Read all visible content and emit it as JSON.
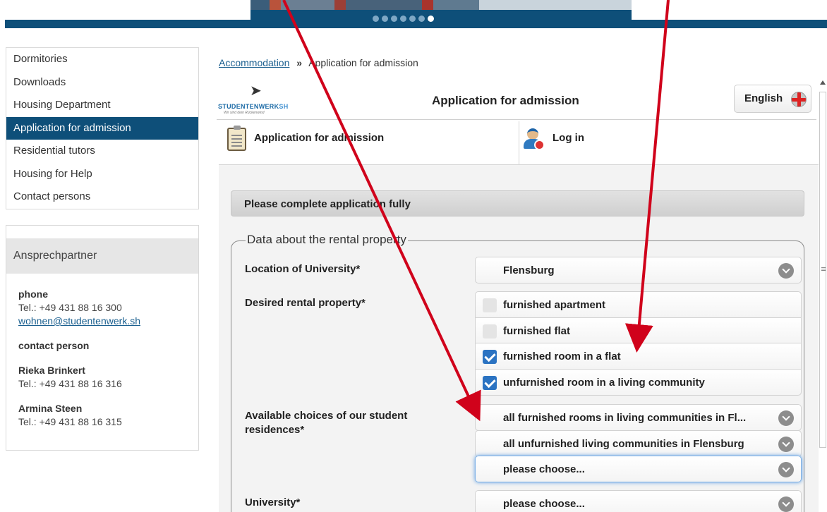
{
  "banner": {
    "dots": 7,
    "active_dot": 7
  },
  "nav": {
    "items": [
      {
        "label": "Dormitories",
        "active": false
      },
      {
        "label": "Downloads",
        "active": false
      },
      {
        "label": "Housing Department",
        "active": false
      },
      {
        "label": "Application for admission",
        "active": true
      },
      {
        "label": "Residential tutors",
        "active": false
      },
      {
        "label": "Housing for Help",
        "active": false
      },
      {
        "label": "Contact persons",
        "active": false
      }
    ]
  },
  "contact": {
    "title": "Ansprechpartner",
    "phone_label": "phone",
    "phone": "Tel.: +49 431 88 16 300",
    "email": "wohnen@studentenwerk.sh",
    "person_label": "contact person",
    "persons": [
      {
        "name": "Rieka Brinkert",
        "phone": "Tel.: +49 431 88 16 316"
      },
      {
        "name": "Armina Steen",
        "phone": "Tel.: +49 431 88 16 315"
      }
    ]
  },
  "breadcrumb": {
    "link": "Accommodation",
    "separator": "»",
    "current": "Application for admission"
  },
  "header": {
    "logo_brand": "STUDENTENWERK",
    "logo_brand_suffix": "SH",
    "logo_tagline": "Wir sind dein Rückenwind",
    "title": "Application for admission",
    "language": "English"
  },
  "subnav": {
    "apply": "Application for admission",
    "login": "Log in"
  },
  "form": {
    "notice": "Please complete application fully",
    "legend": "Data about the rental property",
    "location_label": "Location of University*",
    "location_value": "Flensburg",
    "property_label": "Desired rental property*",
    "property_options": [
      {
        "label": "furnished apartment",
        "checked": false
      },
      {
        "label": "furnished flat",
        "checked": false
      },
      {
        "label": "furnished room in a flat",
        "checked": true
      },
      {
        "label": "unfurnished room in a living community",
        "checked": true
      }
    ],
    "choices_label_1": "Available choices of our student",
    "choices_label_2": "residences*",
    "choices": [
      "all furnished rooms in living communities in Fl...",
      "all unfurnished living communities in Flensburg",
      "please choose..."
    ],
    "university_label": "University*",
    "university_value": "please choose..."
  },
  "colors": {
    "brand_blue": "#0e4f79",
    "checkbox_blue": "#2b73c2",
    "annotation_red": "#d0021b"
  },
  "icons": [
    "paper-plane-icon",
    "uk-flag-icon",
    "clipboard-icon",
    "user-login-icon",
    "chevron-down-icon",
    "checkbox-icon"
  ]
}
